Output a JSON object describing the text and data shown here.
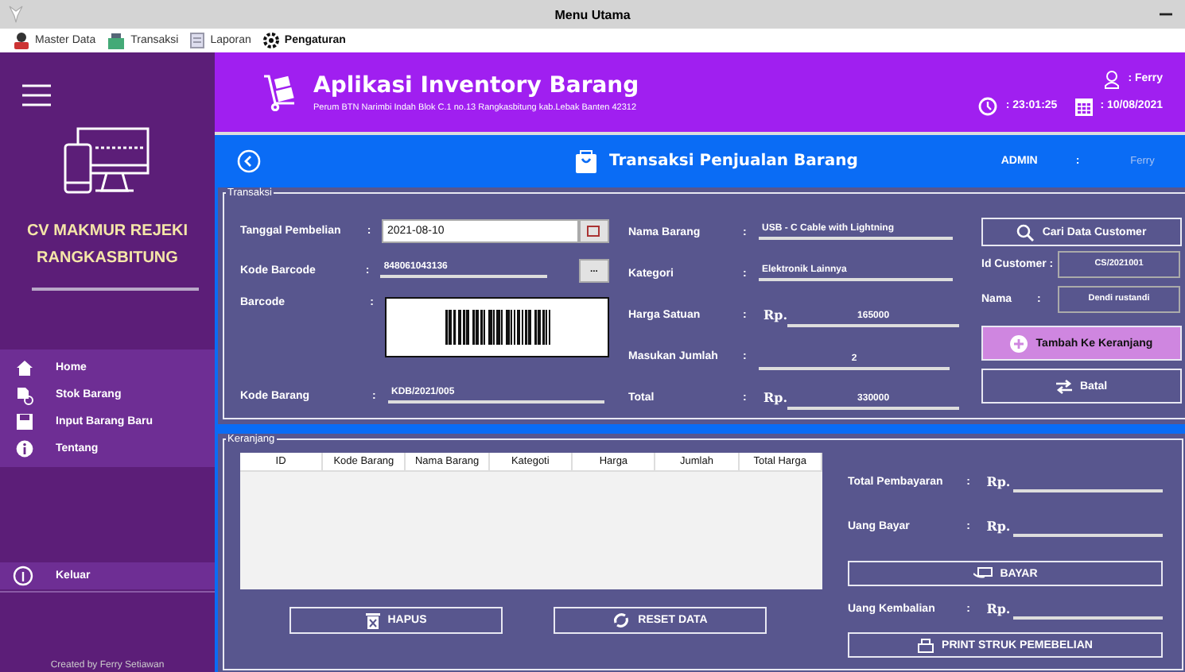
{
  "window": {
    "title": "Menu Utama"
  },
  "menu": [
    {
      "label": "Master Data"
    },
    {
      "label": "Transaksi"
    },
    {
      "label": "Laporan"
    },
    {
      "label": "Pengaturan"
    }
  ],
  "sidebar": {
    "company": "CV MAKMUR REJEKI RANGKASBITUNG",
    "items": [
      {
        "label": "Home"
      },
      {
        "label": "Stok Barang"
      },
      {
        "label": "Input Barang Baru"
      },
      {
        "label": "Tentang"
      }
    ],
    "logout": "Keluar",
    "footer": "Created by Ferry Setiawan"
  },
  "header": {
    "title": "Aplikasi Inventory Barang",
    "address": "Perum BTN Narimbi Indah Blok C.1 no.13 Rangkasbitung kab.Lebak Banten 42312",
    "user": ": Ferry",
    "time": ": 23:01:25",
    "date": ": 10/08/2021"
  },
  "page": {
    "title": "Transaksi Penjualan Barang",
    "role": "ADMIN",
    "colon": ":",
    "user": "Ferry"
  },
  "transaksi": {
    "legend": "Transaksi",
    "left": [
      {
        "kind": "date",
        "label": "Tanggal Pembelian",
        "colon": ":",
        "value": "2021-08-10"
      },
      {
        "kind": "lookup",
        "label": "Kode Barcode",
        "colon": ":",
        "value": "848061043136",
        "button": "..."
      },
      {
        "kind": "barcode",
        "label": "Barcode",
        "colon": ":"
      },
      {
        "kind": "line",
        "label": "Kode Barang",
        "colon": ":",
        "value": "KDB/2021/005"
      }
    ],
    "middle": [
      {
        "kind": "line",
        "label": "Nama Barang",
        "colon": ":",
        "value": "USB - C Cable with Lightning"
      },
      {
        "kind": "line",
        "label": "Kategori",
        "colon": ":",
        "value": "Elektronik Lainnya"
      },
      {
        "kind": "money",
        "label": "Harga Satuan",
        "colon": ":",
        "currency": "Rp.",
        "value": "165000"
      },
      {
        "kind": "qty",
        "label": "Masukan Jumlah",
        "colon": ":",
        "value": "2"
      },
      {
        "kind": "money",
        "label": "Total",
        "colon": ":",
        "currency": "Rp.",
        "value": "330000"
      }
    ],
    "search_button": "Cari Data Customer",
    "customer": [
      {
        "label": "Id Customer :",
        "value": "CS/2021001"
      },
      {
        "label": "Nama",
        "colon": ":",
        "value": "Dendi rustandi"
      }
    ],
    "add_button": "Tambah Ke Keranjang",
    "cancel_button": "Batal"
  },
  "keranjang": {
    "legend": "Keranjang",
    "columns": [
      "ID",
      "Kode Barang",
      "Nama Barang",
      "Kategoti",
      "Harga",
      "Jumlah",
      "Total Harga"
    ],
    "totals": [
      {
        "label": "Total Pembayaran",
        "colon": ":",
        "currency": "Rp."
      },
      {
        "label": "Uang Bayar",
        "colon": ":",
        "currency": "Rp."
      }
    ],
    "pay_button": "BAYAR",
    "change": {
      "label": "Uang Kembalian",
      "colon": ":",
      "currency": "Rp."
    },
    "delete_button": "HAPUS",
    "reset_button": "RESET DATA",
    "print_button": "PRINT STRUK PEMEBELIAN"
  }
}
